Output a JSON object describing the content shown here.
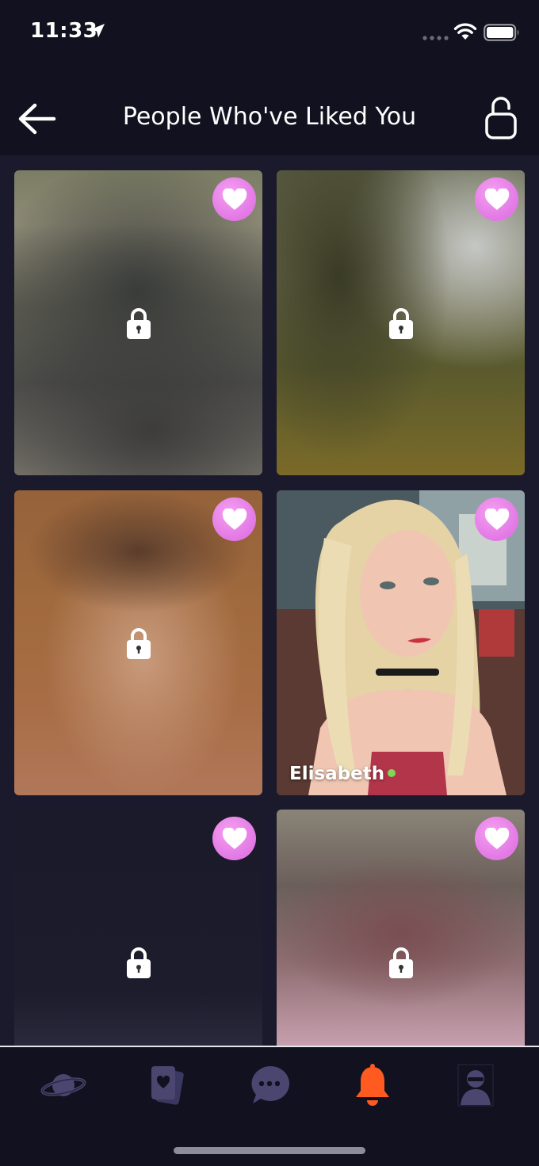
{
  "status_bar": {
    "time": "11:33",
    "icons": [
      "location-arrow-icon",
      "signal-dots-icon",
      "wifi-icon",
      "battery-icon"
    ]
  },
  "header": {
    "title": "People Who've Liked You",
    "back_icon": "arrow-left-icon",
    "unlock_icon": "unlock-icon"
  },
  "colors": {
    "background": "#12111f",
    "grid_background": "#1b1a2d",
    "heart_badge": "#e27ae6",
    "online": "#7ed957",
    "active_tab": "#ff5a1f",
    "inactive_tab": "#4a4670"
  },
  "cards": [
    {
      "locked": true,
      "name": ""
    },
    {
      "locked": true,
      "name": ""
    },
    {
      "locked": true,
      "name": ""
    },
    {
      "locked": false,
      "name": "Elisabeth",
      "online": true
    },
    {
      "locked": true,
      "name": ""
    },
    {
      "locked": true,
      "name": ""
    }
  ],
  "tab_bar": {
    "tabs": [
      {
        "icon": "planet-icon",
        "active": false
      },
      {
        "icon": "cards-icon",
        "active": false
      },
      {
        "icon": "chat-bubble-icon",
        "active": false
      },
      {
        "icon": "bell-icon",
        "active": true
      },
      {
        "icon": "profile-icon",
        "active": false
      }
    ]
  }
}
